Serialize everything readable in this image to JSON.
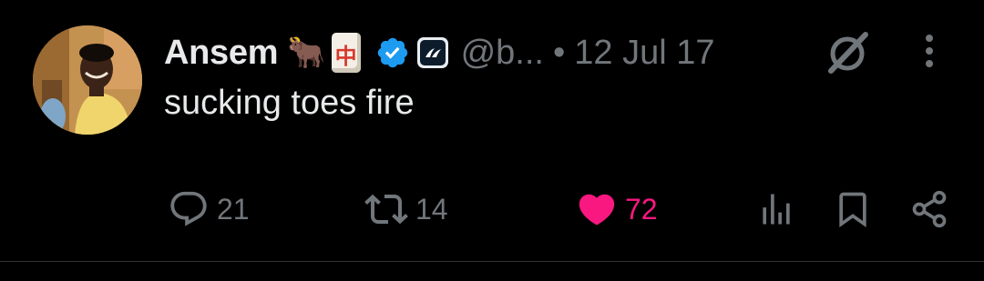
{
  "tweet": {
    "author": {
      "display_name": "Ansem",
      "emoji_1": "🐂",
      "emoji_2": "中",
      "handle": "@b...",
      "verified": true,
      "avatar_icon": "profile-photo"
    },
    "separator": "•",
    "date": "12 Jul 17",
    "text": "sucking toes fire",
    "actions": {
      "reply_count": "21",
      "repost_count": "14",
      "like_count": "72"
    }
  },
  "colors": {
    "background": "#000000",
    "primary_text": "#e7e9ea",
    "secondary_text": "#71767b",
    "like_active": "#f91880",
    "verified_blue": "#1d9bf0",
    "divider": "#2f3336"
  },
  "icons": [
    "profile-photo",
    "bull-emoji",
    "mahjong-emoji",
    "verified-badge-icon",
    "affiliate-badge-icon",
    "grok-icon",
    "more-icon",
    "reply-icon",
    "repost-icon",
    "like-icon",
    "views-icon",
    "bookmark-icon",
    "share-icon"
  ]
}
